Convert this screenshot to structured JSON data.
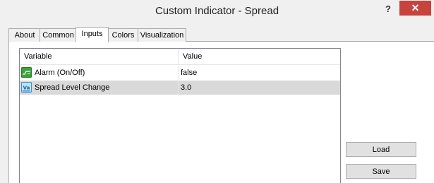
{
  "window": {
    "title": "Custom Indicator - Spread",
    "help_label": "?",
    "close_label": "✕"
  },
  "tabs": [
    {
      "label": "About",
      "active": false
    },
    {
      "label": "Common",
      "active": false
    },
    {
      "label": "Inputs",
      "active": true
    },
    {
      "label": "Colors",
      "active": false
    },
    {
      "label": "Visualization",
      "active": false
    }
  ],
  "grid": {
    "columns": [
      "Variable",
      "Value"
    ],
    "rows": [
      {
        "icon": "boolean-toggle-icon",
        "variable": "Alarm (On/Off)",
        "value": "false",
        "selected": false
      },
      {
        "icon": "numeric-value-icon",
        "variable": "Spread Level Change",
        "value": "3.0",
        "selected": true
      }
    ]
  },
  "buttons": {
    "load_label": "Load",
    "save_label": "Save"
  },
  "colors": {
    "close_bg": "#c7443e",
    "selected_row": "#d9d9d9",
    "bool_icon_green": "#3aa23a",
    "num_icon_blue": "#3b8fd0"
  }
}
